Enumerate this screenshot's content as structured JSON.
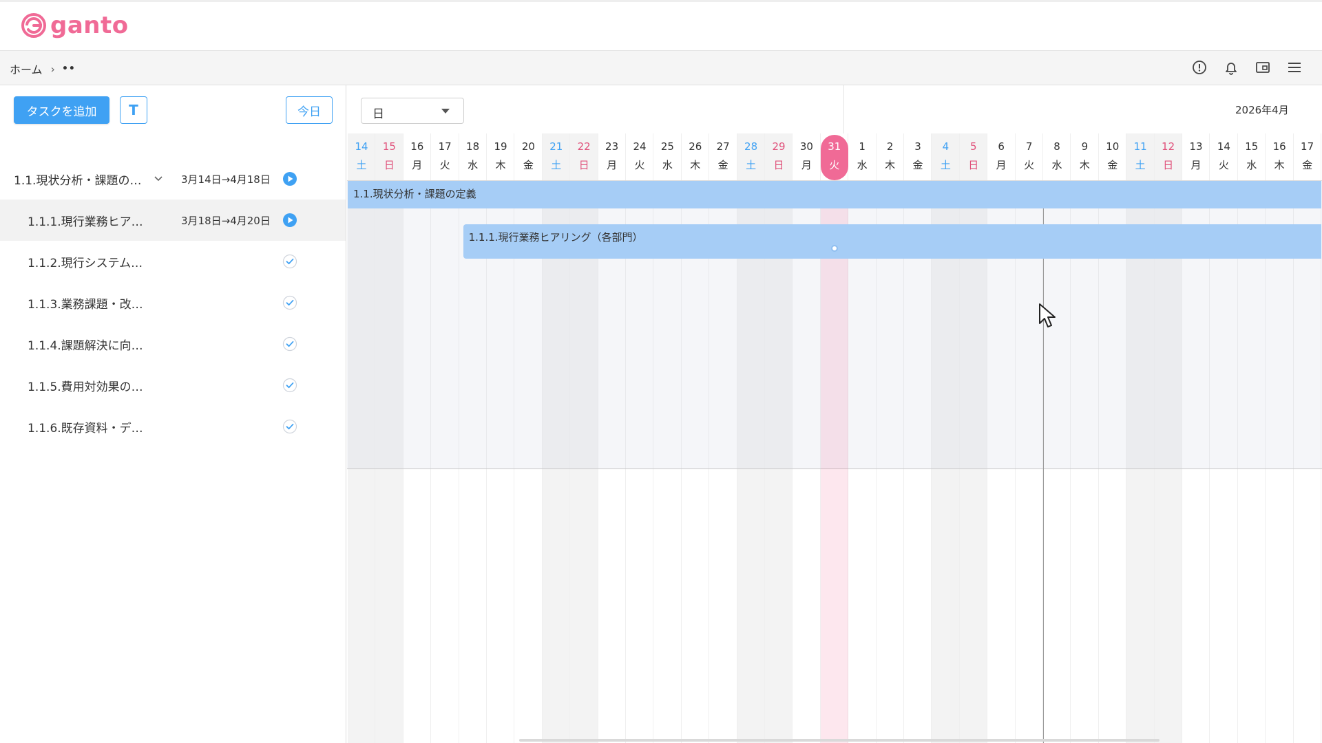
{
  "app": {
    "logo_text": "ganto",
    "brand_color": "#f06a96",
    "accent_color": "#3fa1f3"
  },
  "breadcrumb": {
    "home": "ホーム",
    "separator": "›",
    "current": "••"
  },
  "header_icons": [
    "info-icon",
    "bell-icon",
    "window-icon",
    "menu-icon"
  ],
  "toolbar": {
    "add_task": "タスクを追加",
    "t_button": "T",
    "today_button": "今日"
  },
  "tasks": [
    {
      "name": "1.1.現状分析・課題の…",
      "dates": "3月14日→4月18日",
      "status": "play",
      "indent": 0,
      "group": true
    },
    {
      "name": "1.1.1.現行業務ヒア…",
      "dates": "3月18日→4月20日",
      "status": "play",
      "indent": 1,
      "group": false,
      "selected": true
    },
    {
      "name": "1.1.2.現行システム…",
      "dates": "",
      "status": "check",
      "indent": 1,
      "group": false
    },
    {
      "name": "1.1.3.業務課題・改…",
      "dates": "",
      "status": "check",
      "indent": 1,
      "group": false
    },
    {
      "name": "1.1.4.課題解決に向…",
      "dates": "",
      "status": "check",
      "indent": 1,
      "group": false
    },
    {
      "name": "1.1.5.費用対効果の…",
      "dates": "",
      "status": "check",
      "indent": 1,
      "group": false
    },
    {
      "name": "1.1.6.既存資料・デ…",
      "dates": "",
      "status": "check",
      "indent": 1,
      "group": false
    }
  ],
  "gantt": {
    "scale_value": "日",
    "month_label": "2026年4月",
    "days": [
      {
        "d": "14",
        "w": "土",
        "type": "sat"
      },
      {
        "d": "15",
        "w": "日",
        "type": "sun"
      },
      {
        "d": "16",
        "w": "月",
        "type": "week"
      },
      {
        "d": "17",
        "w": "火",
        "type": "week"
      },
      {
        "d": "18",
        "w": "水",
        "type": "week"
      },
      {
        "d": "19",
        "w": "木",
        "type": "week"
      },
      {
        "d": "20",
        "w": "金",
        "type": "week"
      },
      {
        "d": "21",
        "w": "土",
        "type": "sat"
      },
      {
        "d": "22",
        "w": "日",
        "type": "sun"
      },
      {
        "d": "23",
        "w": "月",
        "type": "week"
      },
      {
        "d": "24",
        "w": "火",
        "type": "week"
      },
      {
        "d": "25",
        "w": "水",
        "type": "week"
      },
      {
        "d": "26",
        "w": "木",
        "type": "week"
      },
      {
        "d": "27",
        "w": "金",
        "type": "week"
      },
      {
        "d": "28",
        "w": "土",
        "type": "sat"
      },
      {
        "d": "29",
        "w": "日",
        "type": "sun"
      },
      {
        "d": "30",
        "w": "月",
        "type": "week"
      },
      {
        "d": "31",
        "w": "火",
        "type": "today"
      },
      {
        "d": "1",
        "w": "水",
        "type": "week"
      },
      {
        "d": "2",
        "w": "木",
        "type": "week"
      },
      {
        "d": "3",
        "w": "金",
        "type": "week"
      },
      {
        "d": "4",
        "w": "土",
        "type": "sat"
      },
      {
        "d": "5",
        "w": "日",
        "type": "sun"
      },
      {
        "d": "6",
        "w": "月",
        "type": "week"
      },
      {
        "d": "7",
        "w": "火",
        "type": "week"
      },
      {
        "d": "8",
        "w": "水",
        "type": "week"
      },
      {
        "d": "9",
        "w": "木",
        "type": "week"
      },
      {
        "d": "10",
        "w": "金",
        "type": "week"
      },
      {
        "d": "11",
        "w": "土",
        "type": "sat"
      },
      {
        "d": "12",
        "w": "日",
        "type": "sun"
      },
      {
        "d": "13",
        "w": "月",
        "type": "week"
      },
      {
        "d": "14",
        "w": "火",
        "type": "week"
      },
      {
        "d": "15",
        "w": "水",
        "type": "week"
      },
      {
        "d": "16",
        "w": "木",
        "type": "week"
      },
      {
        "d": "17",
        "w": "金",
        "type": "week"
      }
    ],
    "bars": [
      {
        "label": "1.1.現状分析・課題の定義",
        "row": 0,
        "start_index": 0,
        "end_index": 35
      },
      {
        "label": "1.1.1.現行業務ヒアリング（各部門）",
        "row": 1,
        "start_index": 4,
        "end_index": 35
      }
    ],
    "colors": {
      "sat": "#3fa1f3",
      "sun": "#e0507a",
      "weekday": "#333333",
      "today": "#f06a96"
    }
  }
}
